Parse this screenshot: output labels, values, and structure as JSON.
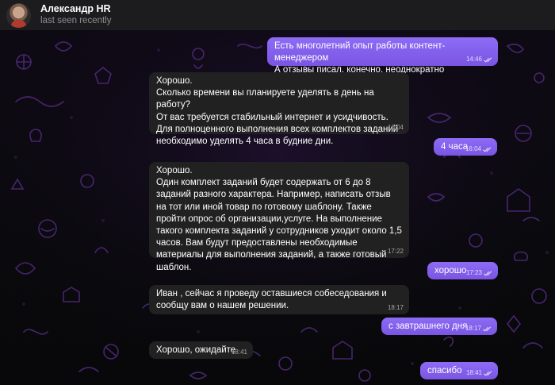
{
  "header": {
    "contact_name": "Александр HR",
    "status": "last seen recently"
  },
  "messages": [
    {
      "dir": "out",
      "text": "Есть многолетний опыт работы контент-менеджером\nА отзывы писал, конечно, неоднократно",
      "time": "14:46",
      "read": true
    },
    {
      "dir": "in",
      "text": "Хорошо.\nСколько времени вы планируете уделять в день на работу?\nОт вас требуется стабильный интернет и усидчивость. Для полноценного выполнения всех комплектов заданий необходимо уделять 4 часа в будние дни.",
      "time": "16:04"
    },
    {
      "dir": "out",
      "text": "4 часа",
      "time": "16:04",
      "read": true
    },
    {
      "dir": "in",
      "text": "Хорошо.\nОдин комплект заданий будет содержать от 6 до 8 заданий разного характера. Например, написать отзыв на тот или иной товар по готовому шаблону. Также пройти опрос об организации,услуге. На выполнение такого комплекта заданий у сотрудников уходит около 1,5 часов. Вам будут предоставлены необходимые материалы для выполнения заданий, а также готовый шаблон.",
      "time": "17:22"
    },
    {
      "dir": "out",
      "text": "хорошо",
      "time": "17:23",
      "read": true
    },
    {
      "dir": "in",
      "text": "Иван , сейчас я проведу оставшиеся собеседования и сообщу вам о нашем решении.",
      "time": "18:17"
    },
    {
      "dir": "out",
      "text": "с завтрашнего дня",
      "time": "18:17",
      "read": true
    },
    {
      "dir": "in",
      "text": "Хорошо, ожидайте",
      "time": "18:41"
    },
    {
      "dir": "out",
      "text": "спасибо",
      "time": "18:41",
      "read": true
    }
  ],
  "colors": {
    "incoming_bubble": "#212121",
    "outgoing_bubble": "#7a55e3",
    "header_bg": "#1c1c1f",
    "doodle": "#5a2f8a"
  },
  "icons": {
    "read_receipt": "double-check-icon",
    "avatar": "avatar"
  }
}
